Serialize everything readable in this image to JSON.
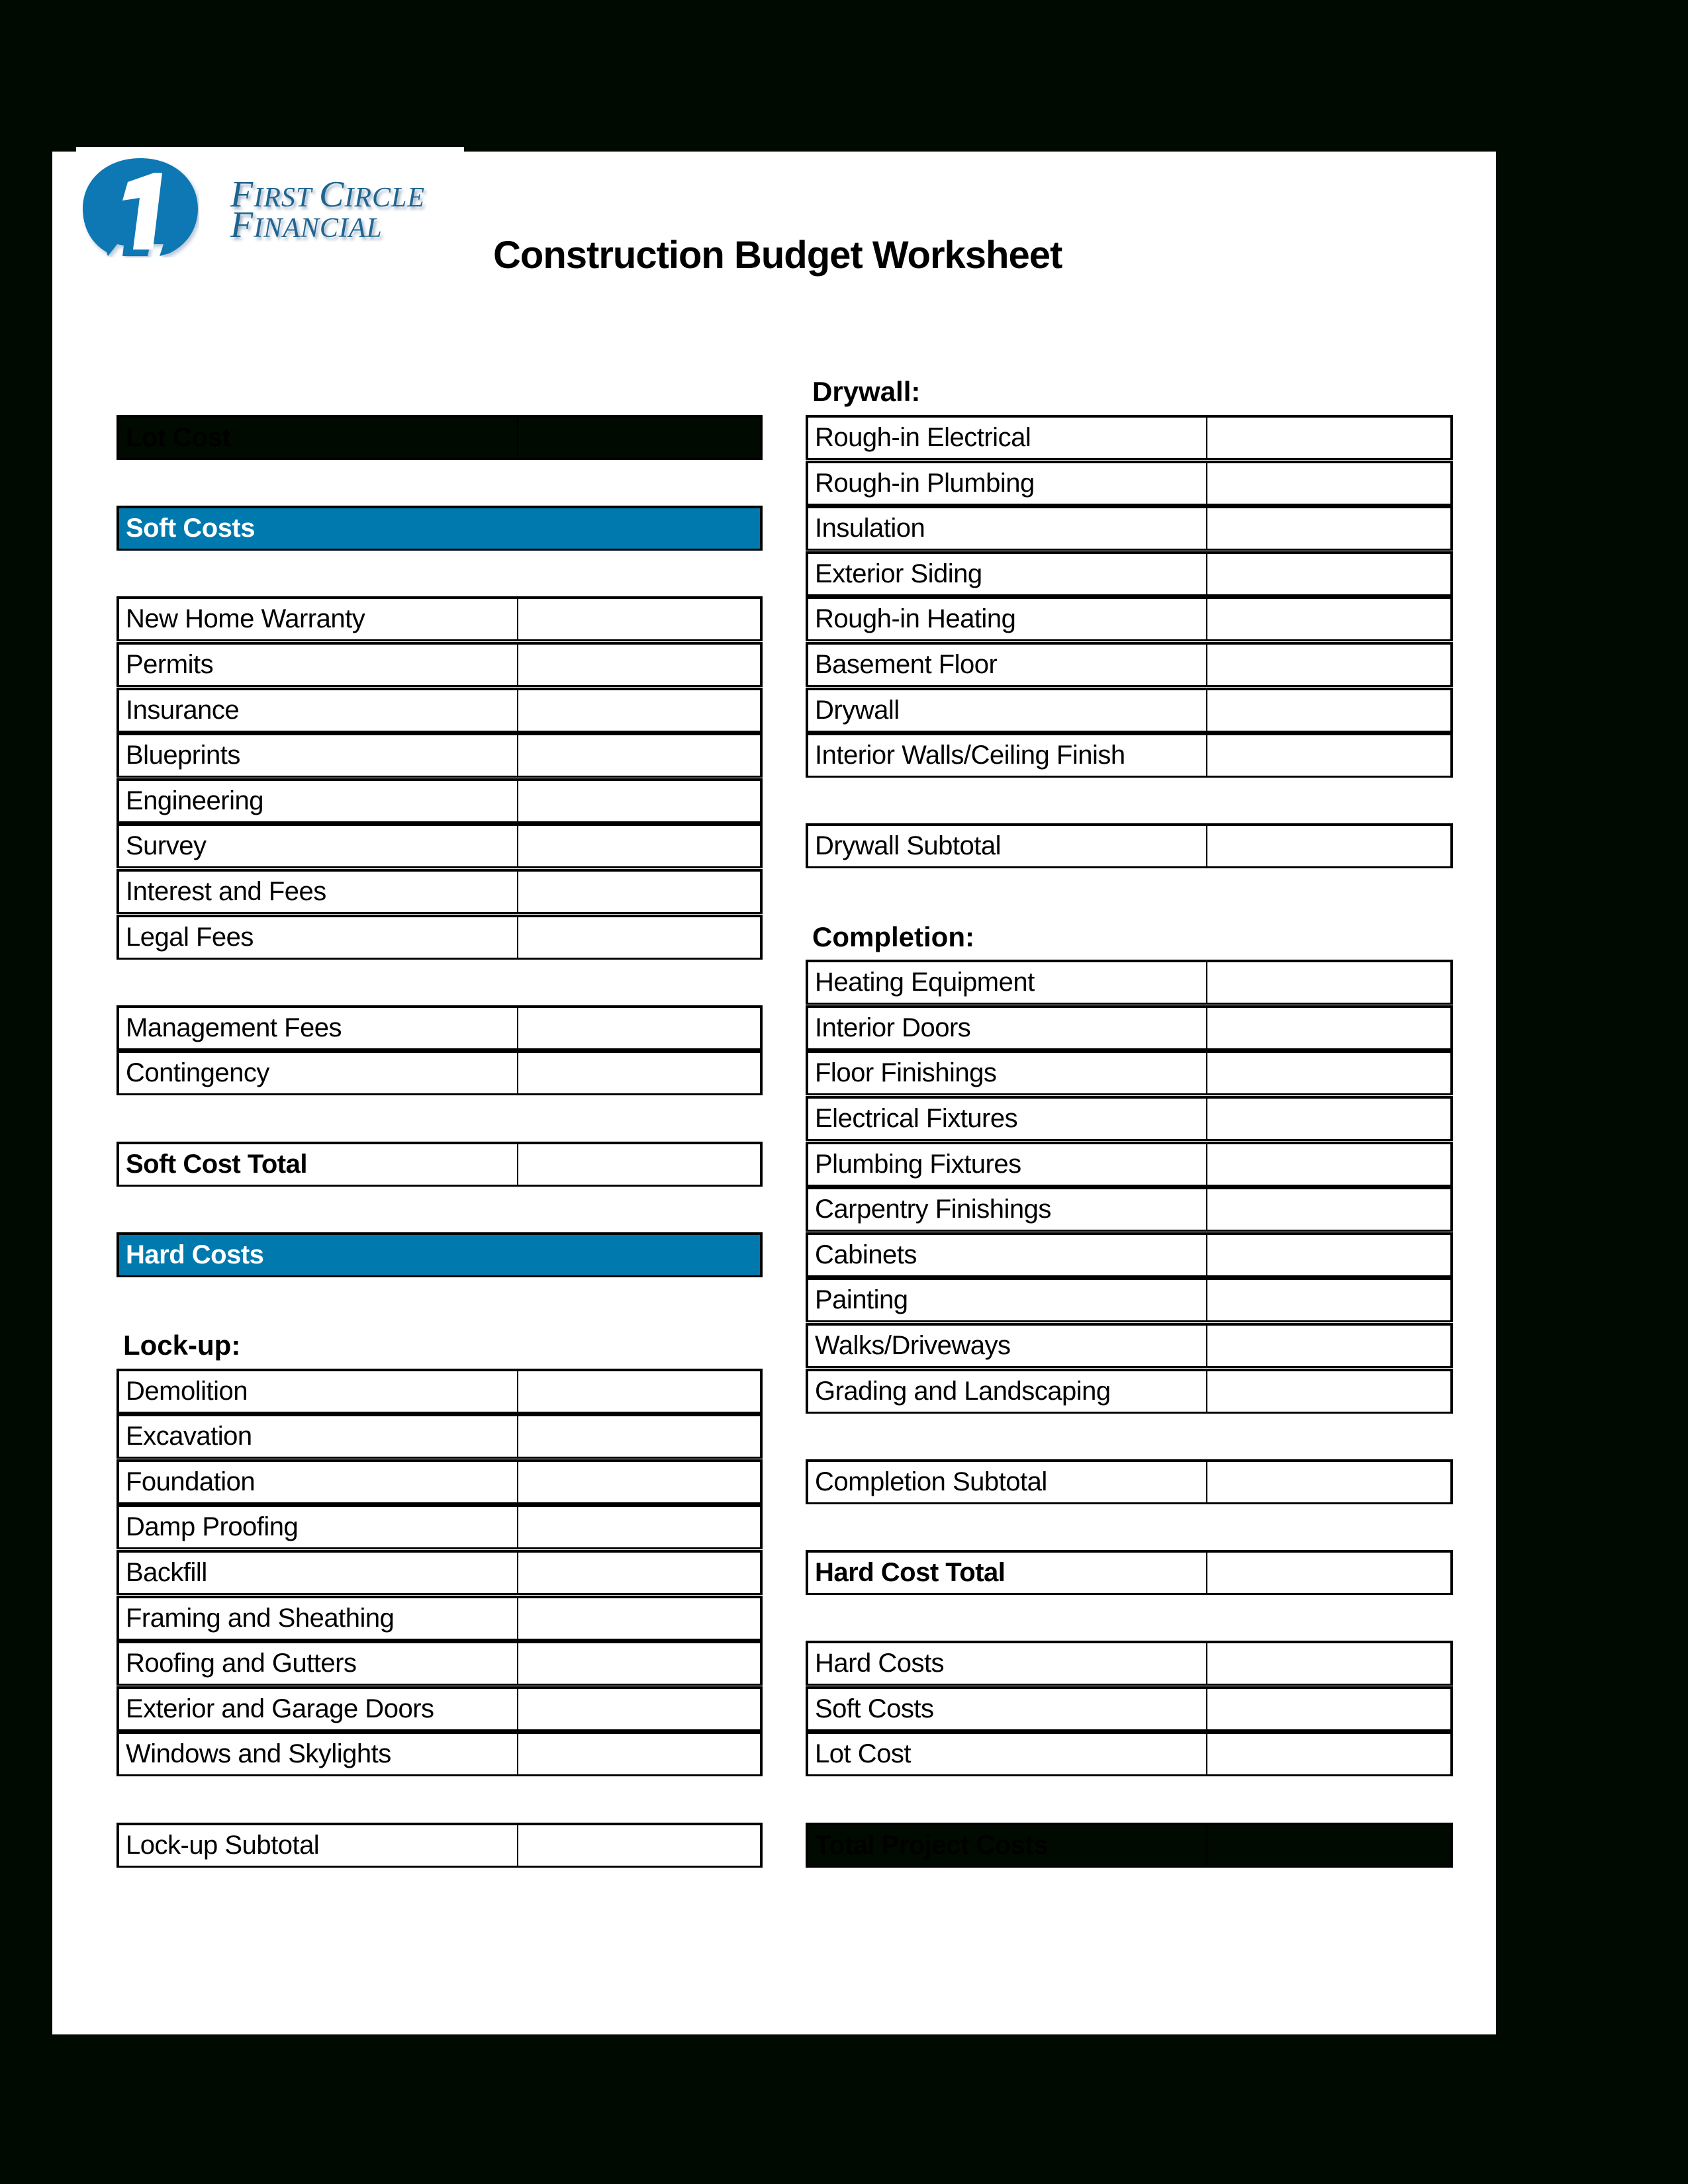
{
  "logo": {
    "line1_parts": [
      "F",
      "IRST ",
      "C",
      "IRCLE"
    ],
    "line2_parts": [
      "F",
      "INANCIAL"
    ],
    "brand_color": "#1f6590"
  },
  "title": "Construction Budget Worksheet",
  "colors": {
    "section_band": "#0079ae",
    "dark_band": "#000a00"
  },
  "left": {
    "lot_cost": "Lot Cost",
    "soft_costs_header": "Soft Costs",
    "soft_items": [
      "New Home Warranty",
      "Permits",
      "Insurance",
      "Blueprints",
      "Engineering",
      "Survey",
      "Interest and Fees",
      "Legal Fees"
    ],
    "soft_items_2": [
      "Management Fees",
      "Contingency"
    ],
    "soft_cost_total": "Soft Cost Total",
    "hard_costs_header": "Hard Costs",
    "lockup_heading": "Lock-up:",
    "lockup_items": [
      "Demolition",
      "Excavation",
      "Foundation",
      "Damp Proofing",
      "Backfill",
      "Framing and Sheathing",
      "Roofing and Gutters",
      "Exterior and Garage Doors",
      "Windows and Skylights"
    ],
    "lockup_subtotal": "Lock-up Subtotal"
  },
  "right": {
    "drywall_heading": "Drywall:",
    "drywall_items": [
      "Rough-in Electrical",
      "Rough-in Plumbing",
      "Insulation",
      "Exterior Siding",
      "Rough-in Heating",
      "Basement Floor",
      "Drywall",
      "Interior Walls/Ceiling Finish"
    ],
    "drywall_subtotal": "Drywall Subtotal",
    "completion_heading": "Completion:",
    "completion_items": [
      "Heating Equipment",
      "Interior Doors",
      "Floor Finishings",
      "Electrical Fixtures",
      "Plumbing Fixtures",
      "Carpentry Finishings",
      "Cabinets",
      "Painting",
      "Walks/Driveways",
      "Grading and Landscaping"
    ],
    "completion_subtotal": "Completion Subtotal",
    "hard_cost_total": "Hard Cost Total",
    "summary_items": [
      "Hard Costs",
      "Soft Costs",
      "Lot Cost"
    ],
    "total_project_costs": "Total Project Costs"
  }
}
